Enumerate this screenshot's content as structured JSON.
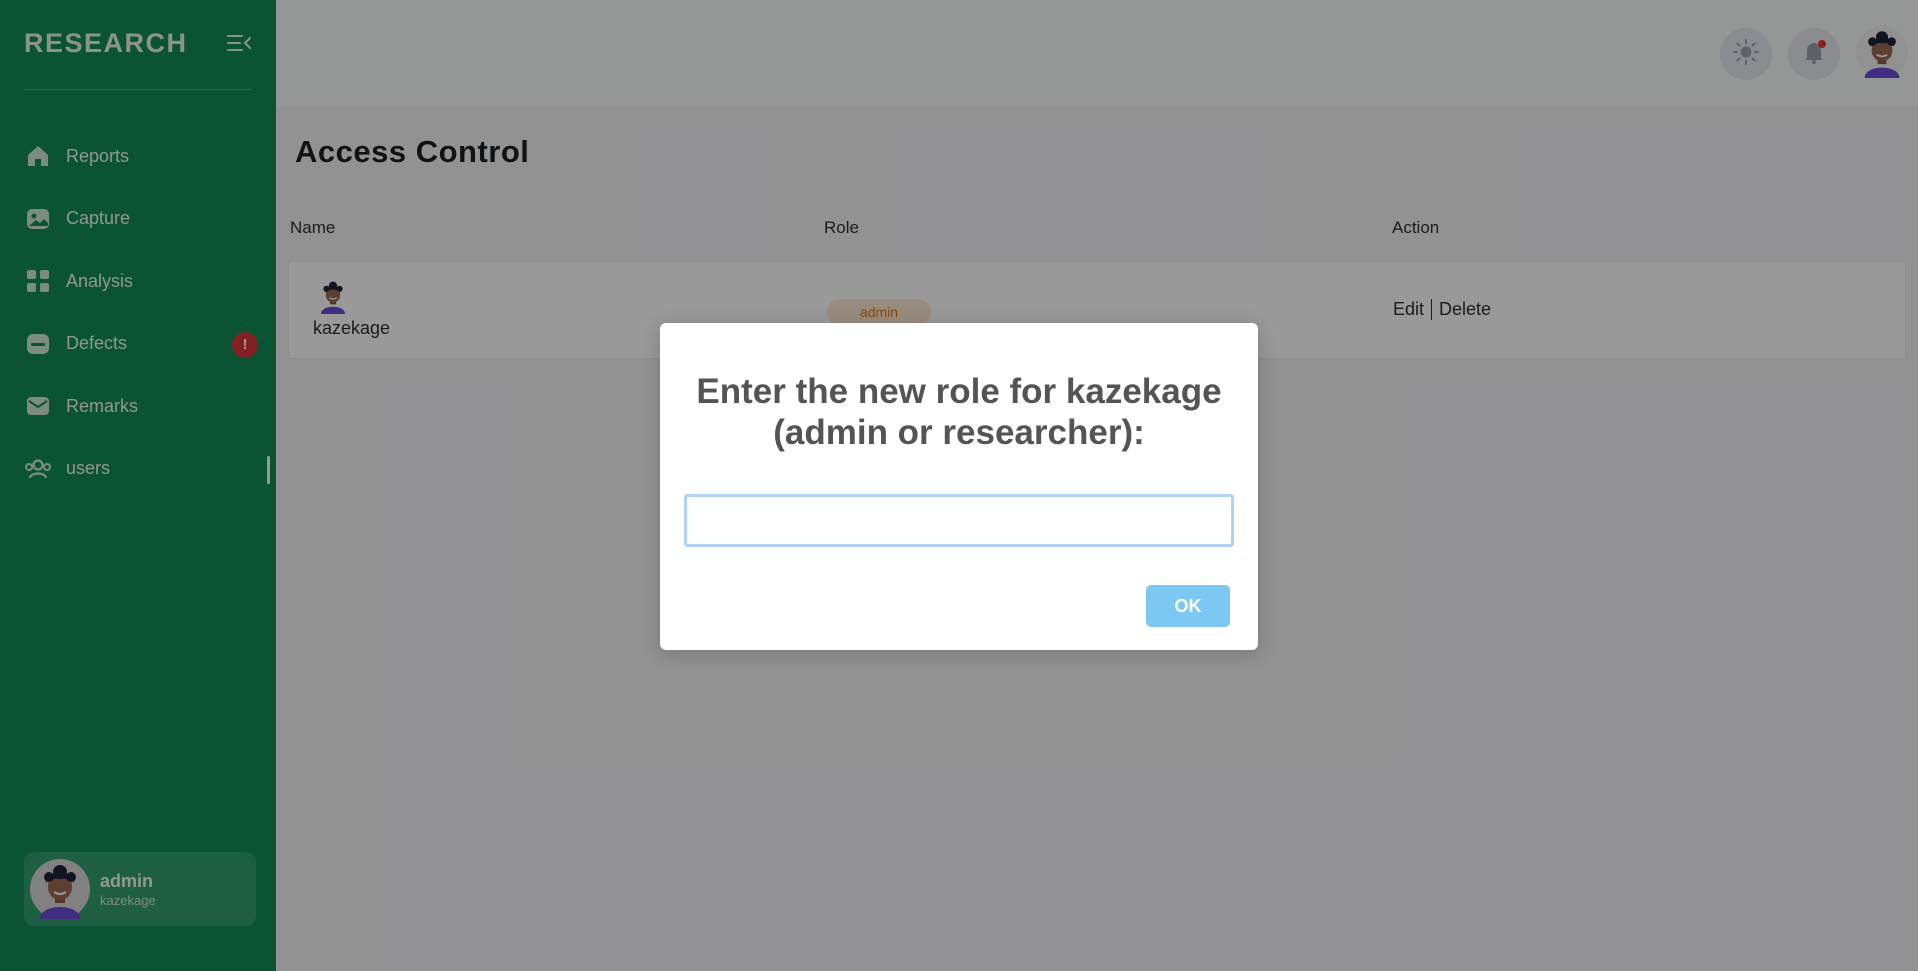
{
  "sidebar": {
    "brand": "RESEARCH",
    "items": [
      {
        "label": "Reports",
        "icon": "home-icon"
      },
      {
        "label": "Capture",
        "icon": "image-icon"
      },
      {
        "label": "Analysis",
        "icon": "grid-icon"
      },
      {
        "label": "Defects",
        "icon": "card-icon",
        "badge": "!"
      },
      {
        "label": "Remarks",
        "icon": "mail-icon"
      },
      {
        "label": "users",
        "icon": "users-icon",
        "active": true
      }
    ],
    "profile": {
      "name": "admin",
      "sub": "kazekage"
    }
  },
  "page": {
    "title": "Access Control"
  },
  "table": {
    "headers": [
      "Name",
      "Role",
      "Action"
    ],
    "rows": [
      {
        "name": "kazekage",
        "role": "admin",
        "edit": "Edit",
        "delete": "Delete"
      }
    ]
  },
  "dialog": {
    "title": "Enter the new role for kazekage (admin or researcher):",
    "input_value": "",
    "ok_label": "OK"
  },
  "colors": {
    "sidebar": "#118d57",
    "badge": "#d9363e",
    "role_pill_bg": "#fde9d2",
    "role_pill_text": "#e27a12",
    "ok_button": "#7cc8f2"
  }
}
